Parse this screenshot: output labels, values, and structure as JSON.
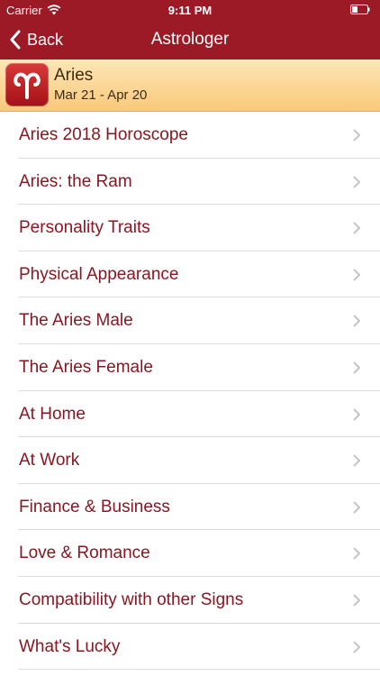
{
  "status_bar": {
    "carrier": "Carrier",
    "time": "9:11 PM",
    "icons": [
      "wifi-icon",
      "battery-icon"
    ]
  },
  "nav": {
    "back_label": "Back",
    "title": "Astrologer"
  },
  "sign": {
    "name": "Aries",
    "dates": "Mar 21 - Apr 20",
    "icon": "aries-symbol-icon"
  },
  "menu": {
    "items": [
      {
        "label": "Aries 2018 Horoscope"
      },
      {
        "label": "Aries: the Ram"
      },
      {
        "label": "Personality Traits"
      },
      {
        "label": "Physical Appearance"
      },
      {
        "label": "The Aries Male"
      },
      {
        "label": "The Aries Female"
      },
      {
        "label": "At Home"
      },
      {
        "label": "At Work"
      },
      {
        "label": "Finance & Business"
      },
      {
        "label": "Love & Romance"
      },
      {
        "label": "Compatibility with other Signs"
      },
      {
        "label": "What's Lucky"
      }
    ]
  },
  "colors": {
    "nav_background": "#9c1a26",
    "item_text": "#8a1621",
    "header_gradient_top": "#fde6b6",
    "header_gradient_bottom": "#f9c97a"
  }
}
